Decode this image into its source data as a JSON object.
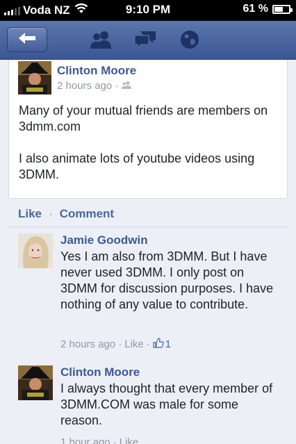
{
  "status_bar": {
    "carrier": "Voda NZ",
    "time": "9:10 PM",
    "battery_percent": "61 %",
    "battery_level": 0.61
  },
  "nav": {
    "back_icon": "back-arrow-icon",
    "icons": [
      "friend-requests-icon",
      "messages-icon",
      "notifications-globe-icon"
    ]
  },
  "post": {
    "author": "Clinton Moore",
    "time": "2 hours ago",
    "separator": "·",
    "privacy_icon": "friends-privacy-icon",
    "body": [
      "Many of your mutual friends are members on 3dmm.com",
      "I also animate lots of youtube videos using 3DMM."
    ]
  },
  "actions": {
    "like_label": "Like",
    "separator": "·",
    "comment_label": "Comment"
  },
  "comments": [
    {
      "author": "Jamie Goodwin",
      "text": "Yes I am also from 3DMM. But I have never used 3DMM. I only post on 3DMM for discussion purposes. I have nothing of any value to contribute.",
      "time": "2 hours ago",
      "like_label": "Like",
      "like_count": "1",
      "separator": "·"
    },
    {
      "author": "Clinton Moore",
      "text": "I always thought that every member of 3DMM.COM was male for some reason.",
      "time": "1 hour ago",
      "like_label": "Like",
      "separator": "·"
    }
  ],
  "colors": {
    "brand_blue": "#3b5998",
    "nav_bar": "#4b67a1",
    "background": "#eceff5",
    "meta_gray": "#9197a3"
  }
}
